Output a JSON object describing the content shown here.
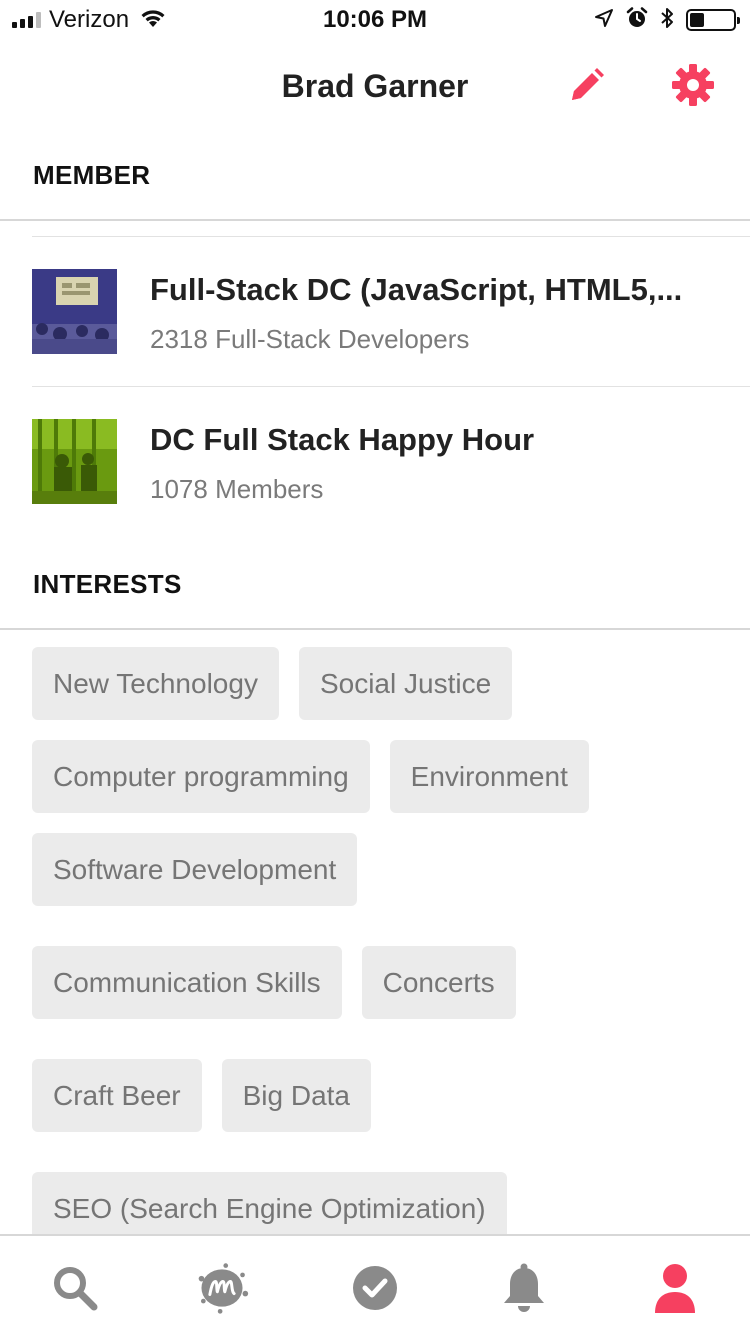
{
  "status_bar": {
    "carrier": "Verizon",
    "time": "10:06 PM",
    "signal_bars_filled": 3,
    "signal_bars_total": 4,
    "battery_level": 0.3,
    "icons": [
      "wifi-icon",
      "location-arrow-icon",
      "alarm-icon",
      "bluetooth-icon",
      "battery-icon"
    ]
  },
  "header": {
    "title": "Brad Garner",
    "edit_icon": "pencil-icon",
    "settings_icon": "gear-icon"
  },
  "colors": {
    "accent": "#f64060",
    "chip_bg": "#ebebeb",
    "chip_text": "#757575",
    "muted_text": "#7a7a7a",
    "tab_inactive": "#8a8a8a"
  },
  "member": {
    "heading": "MEMBER",
    "groups": [
      {
        "name": "Full-Stack DC (JavaScript, HTML5,...",
        "meta": "2318 Full-Stack Developers"
      },
      {
        "name": "DC Full Stack Happy Hour",
        "meta": "1078 Members"
      }
    ]
  },
  "interests": {
    "heading": "INTERESTS",
    "items": [
      "New Technology",
      "Social Justice",
      "Computer programming",
      "Environment",
      "Software Development",
      "Communication Skills",
      "Concerts",
      "Craft Beer",
      "Big Data",
      "SEO (Search Engine Optimization)"
    ]
  },
  "tabbar": {
    "tabs": [
      {
        "icon": "search-icon",
        "active": false
      },
      {
        "icon": "meetup-logo-icon",
        "active": false
      },
      {
        "icon": "checkmark-circle-icon",
        "active": false
      },
      {
        "icon": "bell-icon",
        "active": false
      },
      {
        "icon": "profile-icon",
        "active": true
      }
    ]
  }
}
